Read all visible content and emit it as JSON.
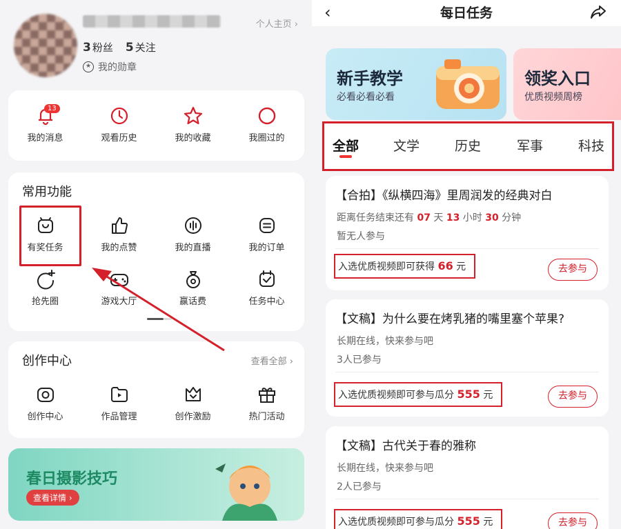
{
  "profile": {
    "homepage_link": "个人主页 ›",
    "fans_count": "3",
    "fans_label": "粉丝",
    "follow_count": "5",
    "follow_label": "关注",
    "medal_label": "我的勋章"
  },
  "quick_row": [
    {
      "label": "我的消息",
      "icon": "bell-icon",
      "badge": "13"
    },
    {
      "label": "观看历史",
      "icon": "clock-icon"
    },
    {
      "label": "我的收藏",
      "icon": "star-icon"
    },
    {
      "label": "我圈过的",
      "icon": "circle-icon"
    }
  ],
  "common_functions": {
    "title": "常用功能",
    "items": [
      {
        "label": "有奖任务",
        "icon": "reward-task-icon"
      },
      {
        "label": "我的点赞",
        "icon": "thumbs-up-icon"
      },
      {
        "label": "我的直播",
        "icon": "live-icon"
      },
      {
        "label": "我的订单",
        "icon": "order-icon"
      },
      {
        "label": "抢先圈",
        "icon": "circle-plus-icon"
      },
      {
        "label": "游戏大厅",
        "icon": "gamepad-icon"
      },
      {
        "label": "赢话费",
        "icon": "money-bag-icon"
      },
      {
        "label": "任务中心",
        "icon": "calendar-check-icon"
      }
    ]
  },
  "creation_center": {
    "title": "创作中心",
    "view_all": "查看全部 ›",
    "items": [
      {
        "label": "创作中心",
        "icon": "camera-icon"
      },
      {
        "label": "作品管理",
        "icon": "video-folder-icon"
      },
      {
        "label": "创作激励",
        "icon": "crown-icon"
      },
      {
        "label": "热门活动",
        "icon": "gift-icon"
      }
    ]
  },
  "banner": {
    "title": "春日摄影技巧",
    "button": "查看详情 ›"
  },
  "daily_tasks": {
    "page_title": "每日任务",
    "promos": [
      {
        "title": "新手教学",
        "subtitle": "必看必看必看"
      },
      {
        "title": "领奖入口",
        "subtitle": "优质视频周榜"
      }
    ],
    "tabs": [
      "全部",
      "文学",
      "历史",
      "军事",
      "科技"
    ],
    "active_tab": "全部",
    "tasks": [
      {
        "title": "【合拍】《纵横四海》里周润发的经典对白",
        "deadline_prefix": "距离任务结束还有",
        "days": "07",
        "days_unit": "天",
        "hours": "13",
        "hours_unit": "小时",
        "minutes": "30",
        "minutes_unit": "分钟",
        "participants": "暂无人参与",
        "reward_prefix": "入选优质视频即可获得",
        "reward_amount": "66",
        "reward_unit": "元",
        "join_label": "去参与"
      },
      {
        "title": "【文稿】为什么要在烤乳猪的嘴里塞个苹果?",
        "status": "长期在线，快来参与吧",
        "participants": "3人已参与",
        "reward_prefix": "入选优质视频即可参与瓜分",
        "reward_amount": "555",
        "reward_unit": "元",
        "join_label": "去参与"
      },
      {
        "title": "【文稿】古代关于春的雅称",
        "status": "长期在线，快来参与吧",
        "participants": "2人已参与",
        "reward_prefix": "入选优质视频即可参与瓜分",
        "reward_amount": "555",
        "reward_unit": "元",
        "join_label": "去参与"
      }
    ]
  },
  "colors": {
    "accent_red": "#d4202a",
    "banner_green": "#1d8a63"
  }
}
